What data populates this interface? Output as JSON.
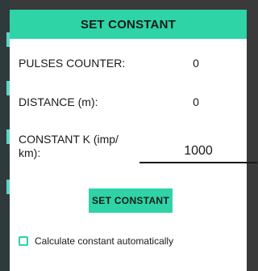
{
  "dialog": {
    "title": "SET CONSTANT",
    "pulses_label": "PULSES COUNTER:",
    "pulses_value": "0",
    "distance_label": "DISTANCE (m):",
    "distance_value": "0",
    "constant_label": "CONSTANT K (imp/ km):",
    "constant_value": "1000",
    "set_button": "SET CONSTANT",
    "auto_checkbox_label": "Calculate constant automatically",
    "auto_checked": false
  },
  "colors": {
    "accent": "#2ed3a6",
    "background_overlay": "#3a3a3a"
  }
}
